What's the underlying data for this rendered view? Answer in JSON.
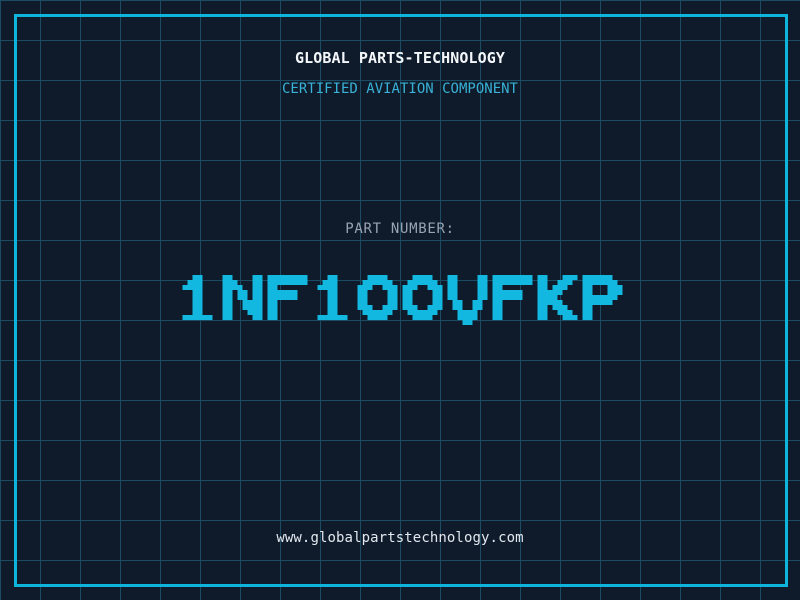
{
  "header": {
    "title": "GLOBAL PARTS-TECHNOLOGY",
    "subtitle": "CERTIFIED AVIATION COMPONENT"
  },
  "part_number": {
    "label": "PART NUMBER:",
    "value": "1NF100VFKP"
  },
  "footer": {
    "website": "www.globalpartstechnology.com"
  },
  "colors": {
    "background": "#0f1a2a",
    "grid_line": "#1b4c63",
    "frame_cyan": "#0db4dc",
    "part_number_cyan": "#12b8e0",
    "subtitle_cyan": "#38b2d6",
    "label_gray": "#9aa4b2",
    "title_white": "#f3f7fa",
    "url_white": "#e2e8ef"
  }
}
